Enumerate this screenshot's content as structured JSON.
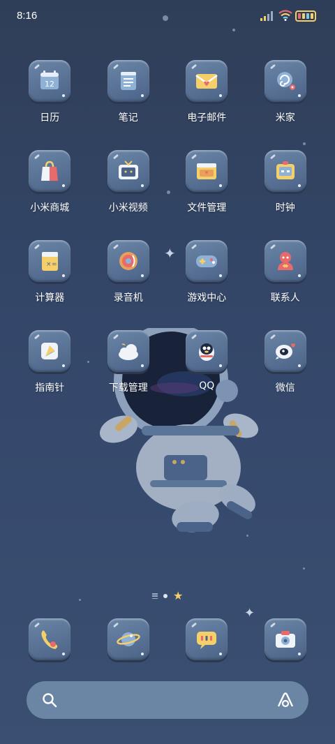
{
  "status_bar": {
    "time": "8:16",
    "signal_icon": "signal-bars-icon",
    "wifi_icon": "wifi-icon",
    "battery_icon": "battery-icon",
    "battery_colors": [
      "#e86a6a",
      "#f4cf6a",
      "#7fc6e8",
      "#f4cf6a"
    ]
  },
  "apps": [
    [
      {
        "label": "日历",
        "icon": "calendar-icon",
        "name": "app-calendar",
        "badge": "12"
      },
      {
        "label": "笔记",
        "icon": "notes-icon",
        "name": "app-notes"
      },
      {
        "label": "电子邮件",
        "icon": "mail-icon",
        "name": "app-email"
      },
      {
        "label": "米家",
        "icon": "mihome-icon",
        "name": "app-mihome"
      }
    ],
    [
      {
        "label": "小米商城",
        "icon": "shopping-bag-icon",
        "name": "app-mi-store"
      },
      {
        "label": "小米视频",
        "icon": "tv-icon",
        "name": "app-mi-video"
      },
      {
        "label": "文件管理",
        "icon": "folder-icon",
        "name": "app-file-manager"
      },
      {
        "label": "时钟",
        "icon": "clock-icon",
        "name": "app-clock"
      }
    ],
    [
      {
        "label": "计算器",
        "icon": "calculator-icon",
        "name": "app-calculator"
      },
      {
        "label": "录音机",
        "icon": "recorder-icon",
        "name": "app-recorder"
      },
      {
        "label": "游戏中心",
        "icon": "gamepad-icon",
        "name": "app-game-center"
      },
      {
        "label": "联系人",
        "icon": "contacts-icon",
        "name": "app-contacts"
      }
    ],
    [
      {
        "label": "指南针",
        "icon": "compass-icon",
        "name": "app-compass"
      },
      {
        "label": "下载管理",
        "icon": "download-cloud-icon",
        "name": "app-downloads"
      },
      {
        "label": "QQ",
        "icon": "qq-penguin-icon",
        "name": "app-qq"
      },
      {
        "label": "微信",
        "icon": "wechat-icon",
        "name": "app-wechat"
      }
    ]
  ],
  "dock": [
    {
      "icon": "phone-icon",
      "name": "dock-phone"
    },
    {
      "icon": "planet-icon",
      "name": "dock-browser"
    },
    {
      "icon": "message-icon",
      "name": "dock-messages"
    },
    {
      "icon": "camera-icon",
      "name": "dock-camera"
    }
  ],
  "search": {
    "placeholder": "",
    "search_icon": "search-icon",
    "lens_icon": "ai-lens-icon"
  },
  "colors": {
    "background_top": "#2f3e58",
    "background_bottom": "#3a4f72",
    "tile": "#5b7598",
    "search_bar": "#6b85a5",
    "accent_yellow": "#f4cf6a"
  }
}
